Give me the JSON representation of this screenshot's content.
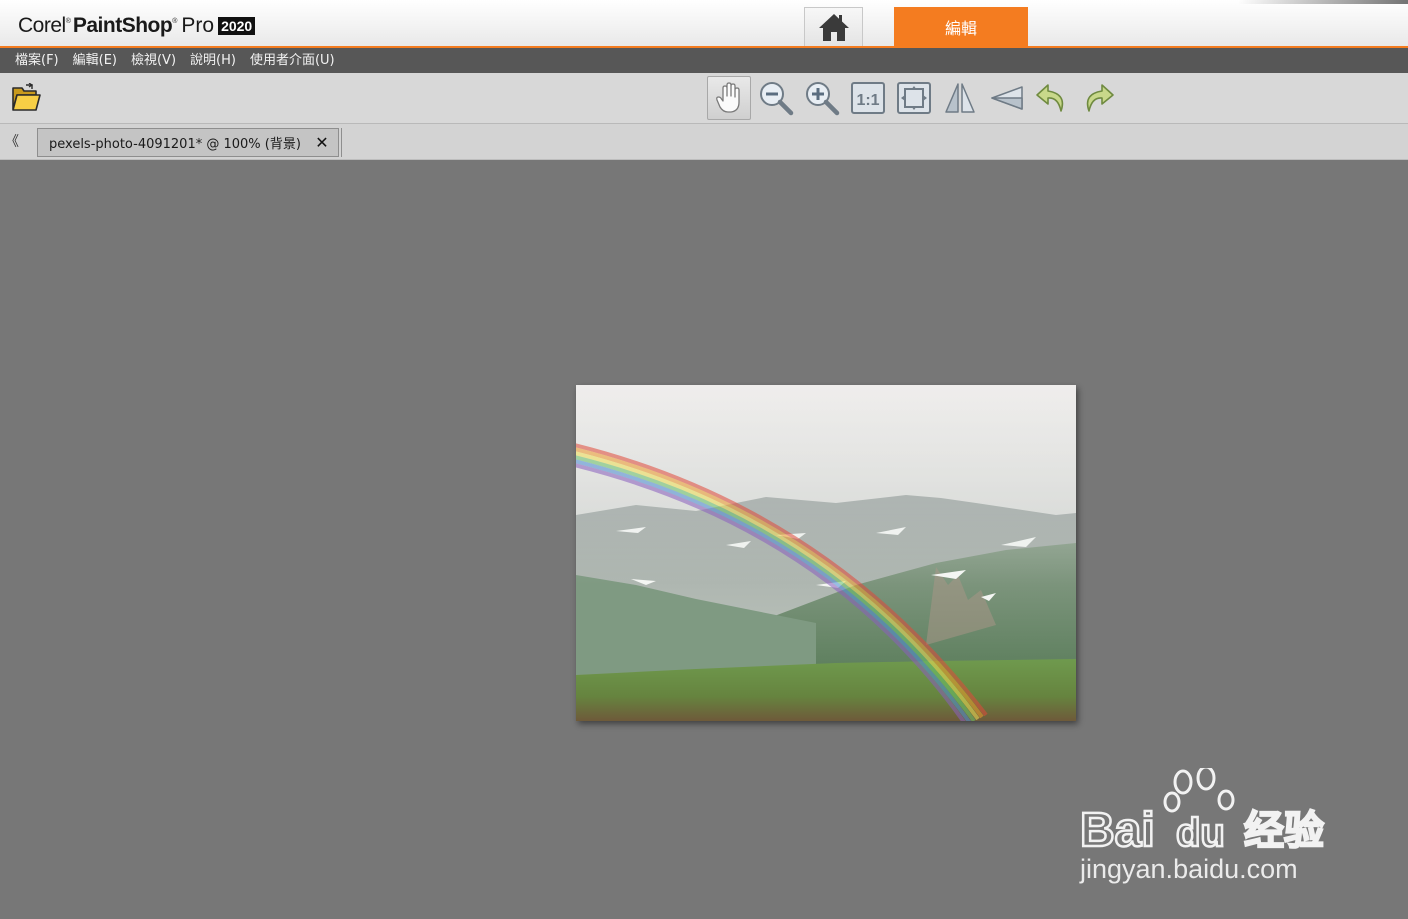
{
  "app": {
    "logo_corel": "Corel",
    "logo_paintshop": "PaintShop",
    "logo_pro": "Pro",
    "logo_year": "2020",
    "home_icon": "home-icon",
    "edit_tab_label": "編輯",
    "accent_color": "#f47c20"
  },
  "menu": {
    "items": [
      {
        "label": "檔案(F)"
      },
      {
        "label": "編輯(E)"
      },
      {
        "label": "檢視(V)"
      },
      {
        "label": "說明(H)"
      },
      {
        "label": "使用者介面(U)"
      }
    ]
  },
  "toolbar": {
    "open_icon": "folder-open-icon",
    "tools": [
      {
        "name": "pan-tool",
        "icon": "hand-icon",
        "active": true
      },
      {
        "name": "zoom-out",
        "icon": "zoom-out-icon",
        "active": false
      },
      {
        "name": "zoom-in",
        "icon": "zoom-in-icon",
        "active": false
      },
      {
        "name": "actual-size",
        "icon": "actual-size-icon",
        "active": false
      },
      {
        "name": "fit-window",
        "icon": "fit-to-window-icon",
        "active": false
      },
      {
        "name": "flip",
        "icon": "flip-icon",
        "active": false
      },
      {
        "name": "perspective",
        "icon": "perspective-icon",
        "active": false
      },
      {
        "name": "undo",
        "icon": "undo-icon",
        "active": false
      },
      {
        "name": "redo",
        "icon": "redo-icon",
        "active": false
      }
    ]
  },
  "document": {
    "tab_label": "pexels-photo-4091201* @ 100% (背景)",
    "close_symbol": "✕",
    "scroll_left_symbol": "《"
  },
  "watermark": {
    "brand": "Bai",
    "brand_du": "du",
    "brand_cn": "经验",
    "url": "jingyan.baidu.com"
  }
}
